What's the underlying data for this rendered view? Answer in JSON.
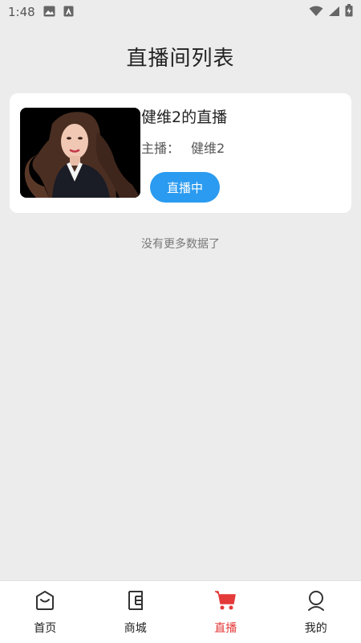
{
  "status_bar": {
    "time": "1:48"
  },
  "page": {
    "title": "直播间列表"
  },
  "rooms": [
    {
      "title": "健维2的直播",
      "host_label": "主播：",
      "host_name": "健维2",
      "status_button": "直播中"
    }
  ],
  "footer": {
    "no_more_text": "没有更多数据了"
  },
  "bottom_nav": {
    "active_color": "#e43a3a",
    "items": [
      {
        "label": "首页",
        "icon": "home-bag-icon"
      },
      {
        "label": "商城",
        "icon": "mall-icon"
      },
      {
        "label": "直播",
        "icon": "live-cart-icon",
        "active": true
      },
      {
        "label": "我的",
        "icon": "user-icon"
      }
    ]
  }
}
